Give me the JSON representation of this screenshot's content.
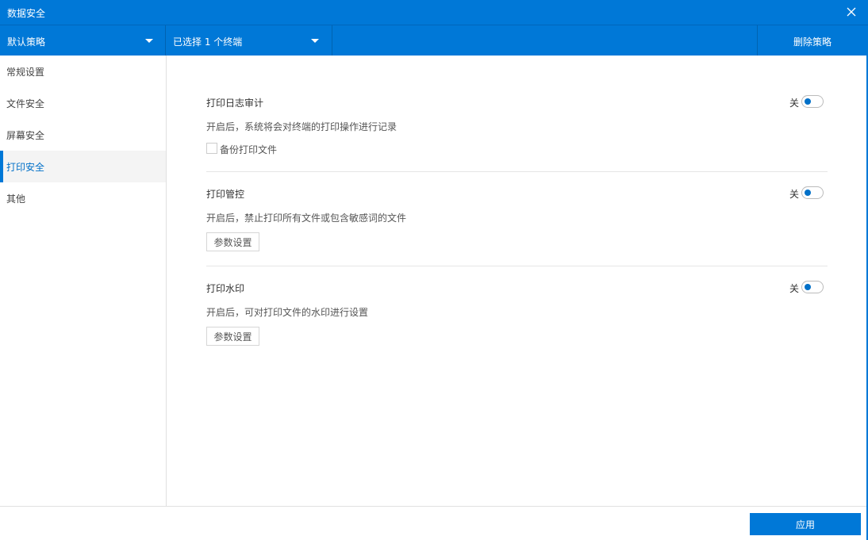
{
  "window": {
    "title": "数据安全",
    "close_icon": "close-icon"
  },
  "toolbar": {
    "policy_dropdown": {
      "selected": "默认策略",
      "icon": "caret-down-icon"
    },
    "terminal_dropdown": {
      "selected": "已选择 1 个终端",
      "icon": "caret-down-icon"
    },
    "delete_label": "删除策略"
  },
  "sidebar": {
    "items": [
      {
        "label": "常规设置",
        "active": false
      },
      {
        "label": "文件安全",
        "active": false
      },
      {
        "label": "屏幕安全",
        "active": false
      },
      {
        "label": "打印安全",
        "active": true
      },
      {
        "label": "其他",
        "active": false
      }
    ]
  },
  "sections": [
    {
      "title": "打印日志审计",
      "description": "开启后，系统将会对终端的打印操作进行记录",
      "toggle_label": "关",
      "toggle_on": false,
      "checkbox": {
        "label": "备份打印文件",
        "checked": false
      }
    },
    {
      "title": "打印管控",
      "description": "开启后，禁止打印所有文件或包含敏感词的文件",
      "toggle_label": "关",
      "toggle_on": false,
      "button_label": "参数设置"
    },
    {
      "title": "打印水印",
      "description": "开启后，可对打印文件的水印进行设置",
      "toggle_label": "关",
      "toggle_on": false,
      "button_label": "参数设置"
    }
  ],
  "footer": {
    "apply_label": "应用"
  },
  "colors": {
    "accent": "#0078d7",
    "active_text": "#0070c8",
    "active_bg": "#f4f4f4"
  }
}
